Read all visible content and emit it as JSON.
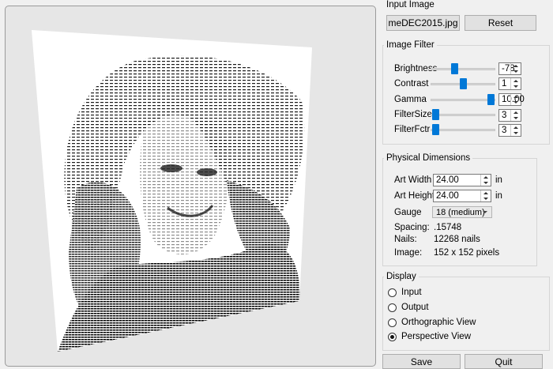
{
  "input_image": {
    "title": "Input Image",
    "file_button": "meDEC2015.jpg",
    "reset_button": "Reset"
  },
  "image_filter": {
    "title": "Image Filter",
    "rows": [
      {
        "label": "Brightness",
        "value": "-78",
        "level": 0.3
      },
      {
        "label": "Contrast",
        "value": "1",
        "level": 0.5
      },
      {
        "label": "Gamma",
        "value": "10.00",
        "level": 1.0
      },
      {
        "label": "FilterSize",
        "value": "3",
        "level": 0.0
      },
      {
        "label": "FilterFctr",
        "value": "3",
        "level": 0.0
      }
    ]
  },
  "physical": {
    "title": "Physical Dimensions",
    "art_width_label": "Art Width",
    "art_width_value": "24.00",
    "art_width_unit": "in",
    "art_height_label": "Art Height",
    "art_height_value": "24.00",
    "art_height_unit": "in",
    "gauge_label": "Gauge",
    "gauge_value": "18 (medium)",
    "spacing_label": "Spacing:",
    "spacing_value": ".15748",
    "nails_label": "Nails:",
    "nails_value": "12268 nails",
    "image_label": "Image:",
    "image_value": "152 x 152 pixels"
  },
  "display": {
    "title": "Display",
    "options": [
      {
        "label": "Input",
        "selected": false
      },
      {
        "label": "Output",
        "selected": false
      },
      {
        "label": "Orthographic View",
        "selected": false
      },
      {
        "label": "Perspective View",
        "selected": true
      }
    ]
  },
  "footer": {
    "save_button": "Save",
    "quit_button": "Quit"
  },
  "colors": {
    "accent": "#0078d7",
    "panel": "#f0f0f0"
  }
}
